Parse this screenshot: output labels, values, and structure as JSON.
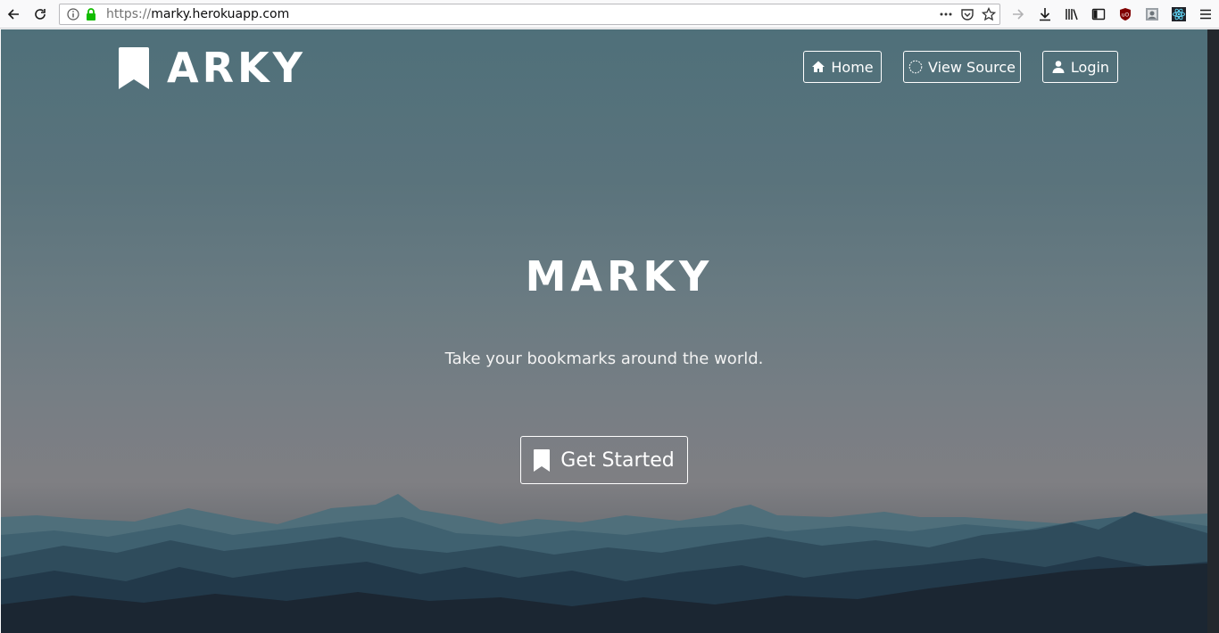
{
  "browser": {
    "url_protocol": "https://",
    "url_host": "marky.herokuapp.com",
    "icons": [
      "back-icon",
      "reload-icon",
      "info-icon",
      "lock-icon",
      "more-actions-icon",
      "pocket-icon",
      "bookmark-star-icon",
      "forward-arrow-icon",
      "downloads-icon",
      "library-icon",
      "sidebar-icon",
      "ublock-icon",
      "extension-icon",
      "react-devtools-icon",
      "menu-icon"
    ]
  },
  "nav": {
    "brand_text": "ARKY",
    "home_label": "Home",
    "source_label": "View Source",
    "login_label": "Login"
  },
  "hero": {
    "title": "MARKY",
    "subtitle": "Take your bookmarks around the world.",
    "cta_label": "Get Started"
  },
  "colors": {
    "sky_top": "#4f707a",
    "sky_mid": "#7f7f83",
    "mountain_dark": "#1b2632",
    "text": "#ffffff"
  }
}
